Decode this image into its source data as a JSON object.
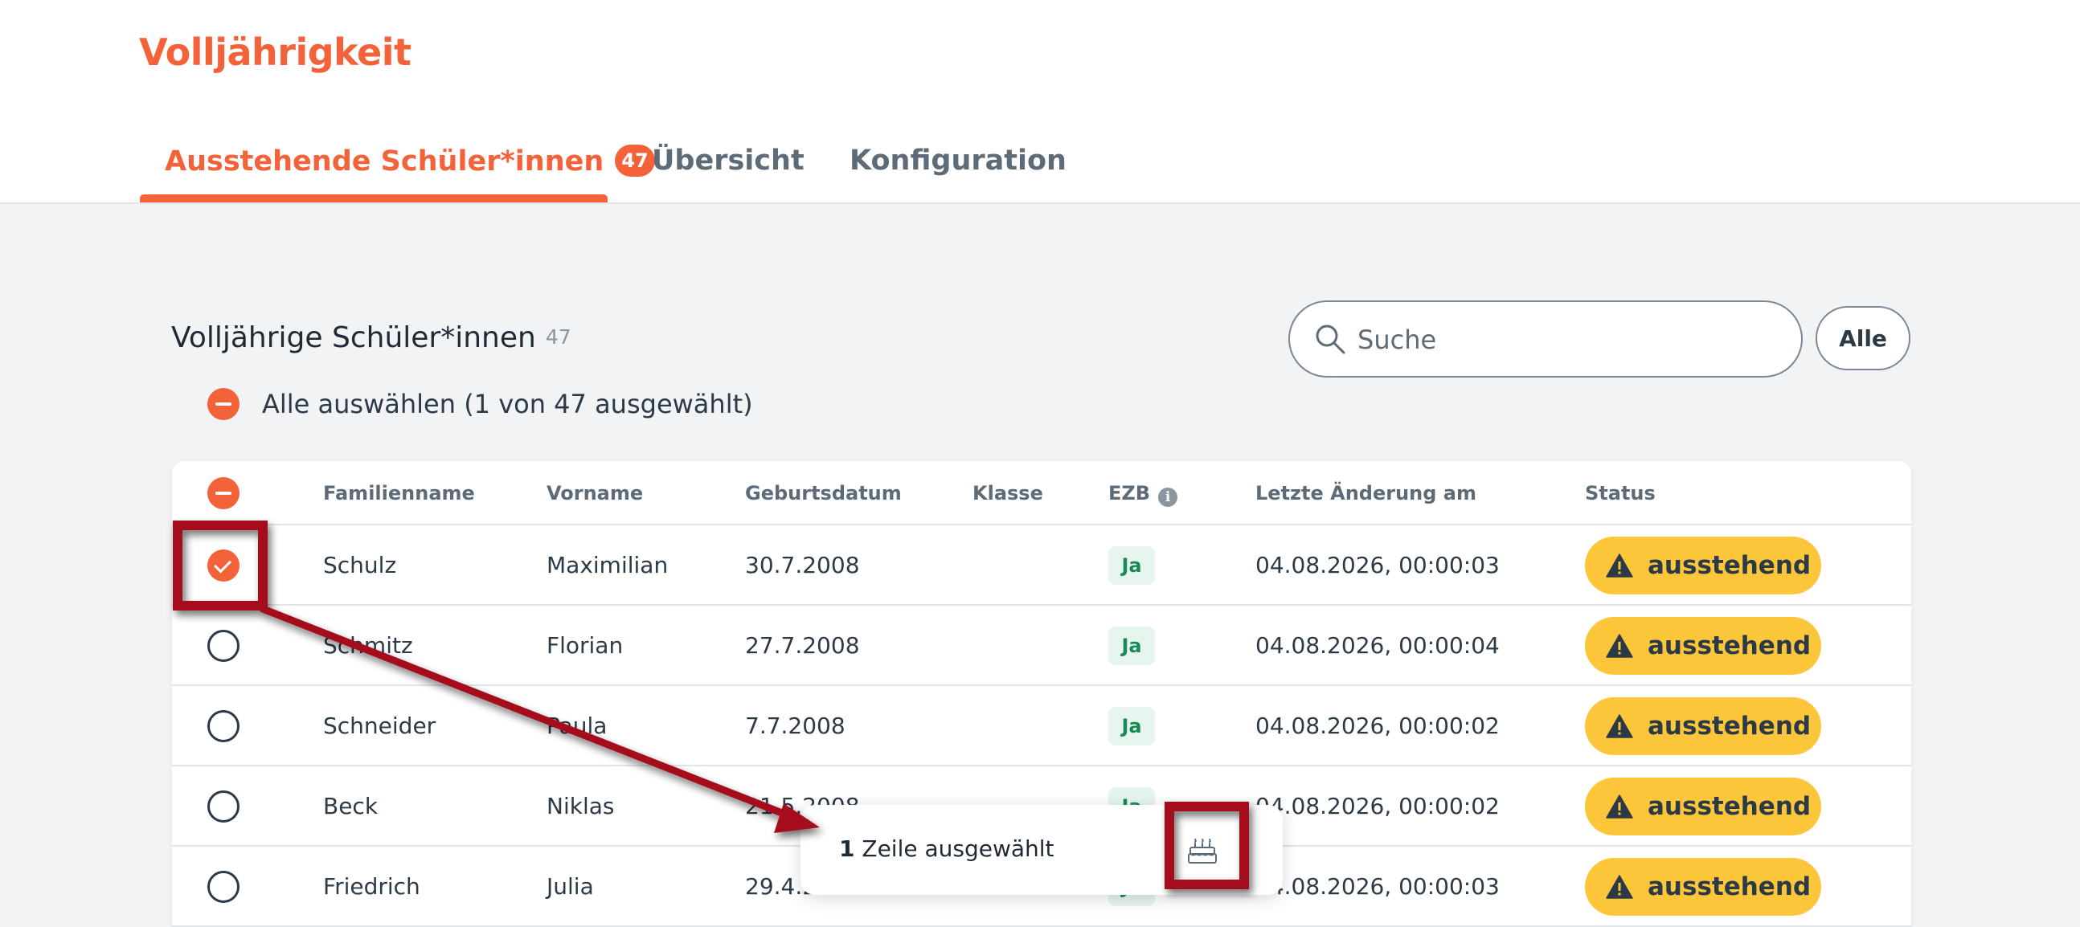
{
  "page": {
    "title": "Volljährigkeit"
  },
  "tabs": [
    {
      "label": "Ausstehende Schüler*innen",
      "badge": "47",
      "active": true
    },
    {
      "label": "Übersicht",
      "active": false
    },
    {
      "label": "Konfiguration",
      "active": false
    }
  ],
  "section": {
    "title": "Volljährige Schüler*innen",
    "count": "47"
  },
  "search": {
    "placeholder": "Suche"
  },
  "filter": {
    "label": "Alle"
  },
  "select_all": {
    "label": "Alle auswählen (1 von 47 ausgewählt)"
  },
  "table": {
    "headers": {
      "family_name": "Familienname",
      "first_name": "Vorname",
      "birth_date": "Geburtsdatum",
      "class": "Klasse",
      "ezb": "EZB",
      "last_change": "Letzte Änderung am",
      "status": "Status"
    },
    "rows": [
      {
        "family_name": "Schulz",
        "first_name": "Maximilian",
        "birth_date": "30.7.2008",
        "class": "",
        "ezb": "Ja",
        "last_change": "04.08.2026, 00:00:03",
        "status": "ausstehend",
        "selected": true
      },
      {
        "family_name": "Schmitz",
        "first_name": "Florian",
        "birth_date": "27.7.2008",
        "class": "",
        "ezb": "Ja",
        "last_change": "04.08.2026, 00:00:04",
        "status": "ausstehend",
        "selected": false
      },
      {
        "family_name": "Schneider",
        "first_name": "Paula",
        "birth_date": "7.7.2008",
        "class": "",
        "ezb": "Ja",
        "last_change": "04.08.2026, 00:00:02",
        "status": "ausstehend",
        "selected": false
      },
      {
        "family_name": "Beck",
        "first_name": "Niklas",
        "birth_date": "21.5.2008",
        "class": "",
        "ezb": "Ja",
        "last_change": "04.08.2026, 00:00:02",
        "status": "ausstehend",
        "selected": false
      },
      {
        "family_name": "Friedrich",
        "first_name": "Julia",
        "birth_date": "29.4.2008",
        "class": "",
        "ezb": "Ja",
        "last_change": "04.08.2026, 00:00:03",
        "status": "ausstehend",
        "selected": false
      }
    ]
  },
  "selection_bar": {
    "count": "1",
    "label": "Zeile ausgewählt",
    "action_icon": "birthday-cake-icon"
  },
  "colors": {
    "accent": "#f4623a",
    "status": "#fcc63a",
    "ezb_bg": "#e6f6ef",
    "annotation": "#a50f1e"
  }
}
